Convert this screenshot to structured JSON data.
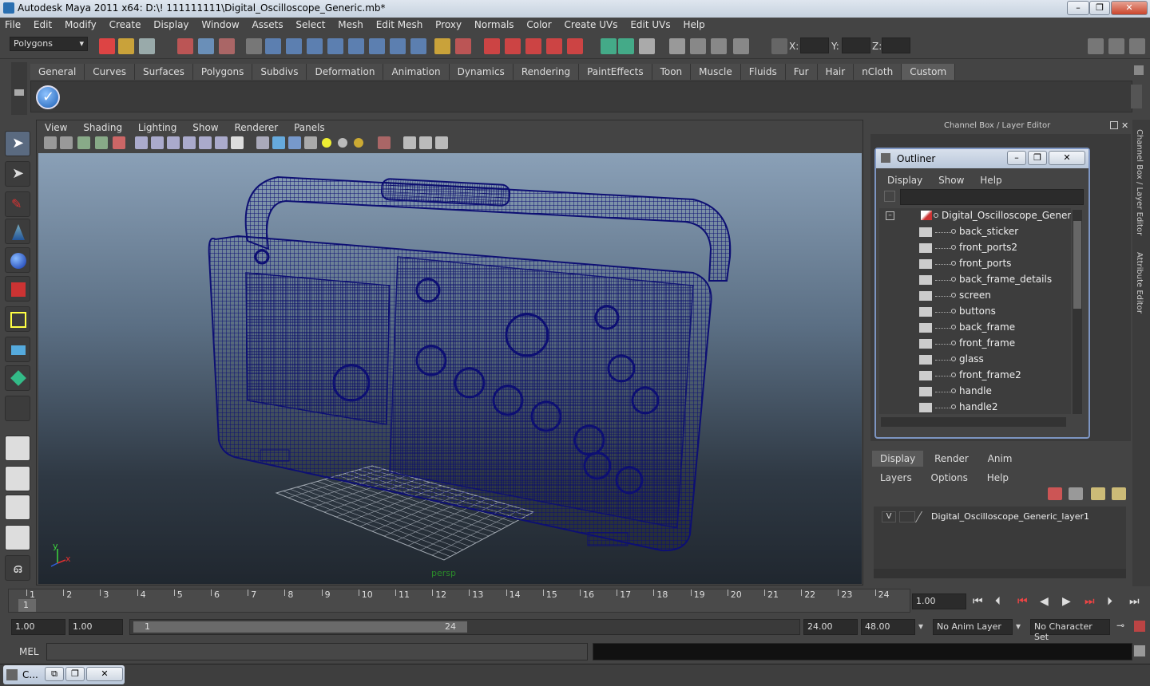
{
  "window": {
    "title": "Autodesk Maya 2011 x64: D:\\! 111111111\\Digital_Oscilloscope_Generic.mb*",
    "minimize": "–",
    "maximize": "❐",
    "close": "✕"
  },
  "menubar": [
    "File",
    "Edit",
    "Modify",
    "Create",
    "Display",
    "Window",
    "Assets",
    "Select",
    "Mesh",
    "Edit Mesh",
    "Proxy",
    "Normals",
    "Color",
    "Create UVs",
    "Edit UVs",
    "Help"
  ],
  "statusline": {
    "mode": "Polygons",
    "x_label": "X:",
    "y_label": "Y:",
    "z_label": "Z:"
  },
  "shelf_tabs": [
    "General",
    "Curves",
    "Surfaces",
    "Polygons",
    "Subdivs",
    "Deformation",
    "Animation",
    "Dynamics",
    "Rendering",
    "PaintEffects",
    "Toon",
    "Muscle",
    "Fluids",
    "Fur",
    "Hair",
    "nCloth",
    "Custom"
  ],
  "shelf_active": "Custom",
  "viewport": {
    "menu": [
      "View",
      "Shading",
      "Lighting",
      "Show",
      "Renderer",
      "Panels"
    ],
    "camera": "persp",
    "axis_y": "y",
    "axis_x": "x"
  },
  "channel_box": {
    "title": "Channel Box / Layer Editor"
  },
  "outliner": {
    "title": "Outliner",
    "menu": [
      "Display",
      "Show",
      "Help"
    ],
    "root": "Digital_Oscilloscope_Generic",
    "collapse": "–",
    "items": [
      "back_sticker",
      "front_ports2",
      "front_ports",
      "back_frame_details",
      "screen",
      "buttons",
      "back_frame",
      "front_frame",
      "glass",
      "front_frame2",
      "handle",
      "handle2"
    ]
  },
  "side_tabs": {
    "channel": "Channel Box / Layer Editor",
    "attribute": "Attribute Editor"
  },
  "layer_editor": {
    "tabs": [
      "Display",
      "Render",
      "Anim"
    ],
    "active_tab": "Display",
    "menu": [
      "Layers",
      "Options",
      "Help"
    ],
    "layer_visible": "V",
    "layer_name": "Digital_Oscilloscope_Generic_layer1"
  },
  "timeline": {
    "frames": [
      "1",
      "2",
      "3",
      "4",
      "5",
      "6",
      "7",
      "8",
      "9",
      "10",
      "11",
      "12",
      "13",
      "14",
      "15",
      "16",
      "17",
      "18",
      "19",
      "20",
      "21",
      "22",
      "23",
      "24"
    ],
    "current_marker": "1",
    "current_time": "1.00"
  },
  "range": {
    "start": "1.00",
    "playback_start": "1.00",
    "slider_start": "1",
    "slider_end": "24",
    "playback_end": "24.00",
    "end": "48.00",
    "anim_layer": "No Anim Layer",
    "character_set": "No Character Set"
  },
  "command": {
    "label": "MEL"
  },
  "taskbar": {
    "minimized_label": "C..."
  },
  "colors": {
    "wireframe": "#0d0f73",
    "ui_bg": "#444444",
    "outliner_border": "#7d95c2"
  }
}
